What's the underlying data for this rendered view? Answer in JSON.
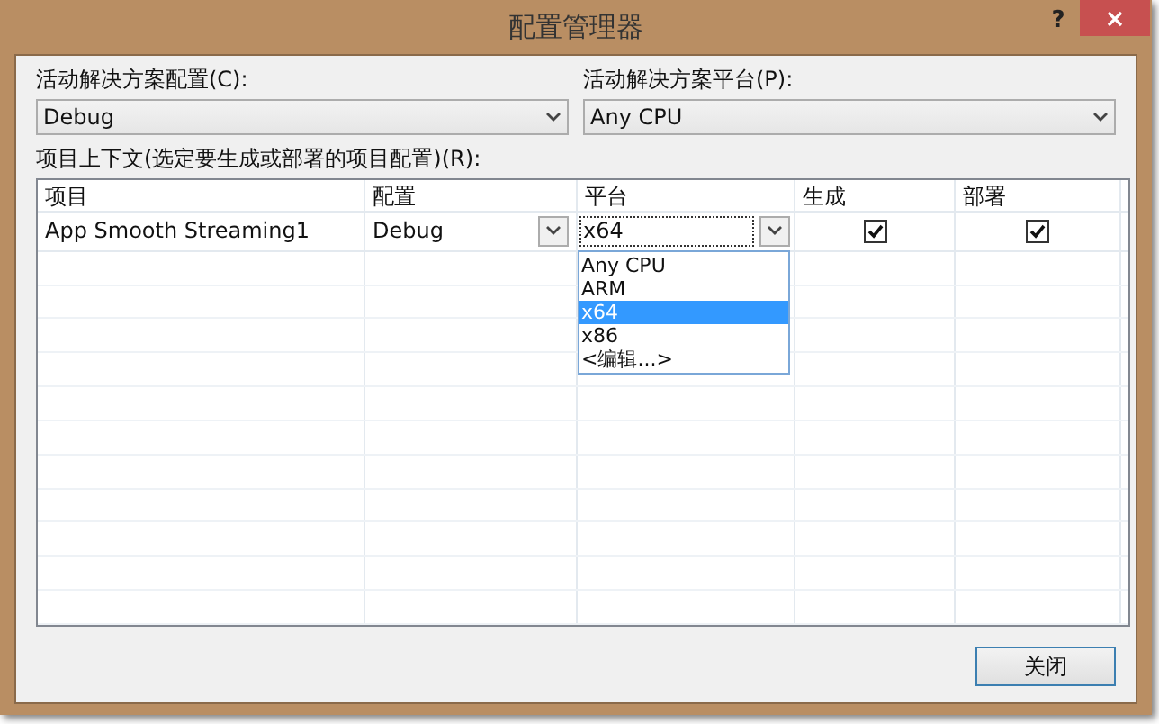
{
  "window": {
    "title": "配置管理器",
    "help": "?"
  },
  "solution_config": {
    "label": "活动解决方案配置(C):",
    "value": "Debug"
  },
  "solution_platform": {
    "label": "活动解决方案平台(P):",
    "value": "Any CPU"
  },
  "context_label": "项目上下文(选定要生成或部署的项目配置)(R):",
  "table": {
    "columns": [
      "项目",
      "配置",
      "平台",
      "生成",
      "部署"
    ],
    "rows": [
      {
        "project": "App Smooth Streaming1",
        "config": "Debug",
        "platform": "x64",
        "build": true,
        "deploy": true
      }
    ]
  },
  "platform_dropdown": {
    "options": [
      {
        "label": "Any CPU",
        "selected": false
      },
      {
        "label": "ARM",
        "selected": false
      },
      {
        "label": "x64",
        "selected": true
      },
      {
        "label": "x86",
        "selected": false
      },
      {
        "label": "<编辑...>",
        "selected": false
      }
    ]
  },
  "close_button": "关闭"
}
